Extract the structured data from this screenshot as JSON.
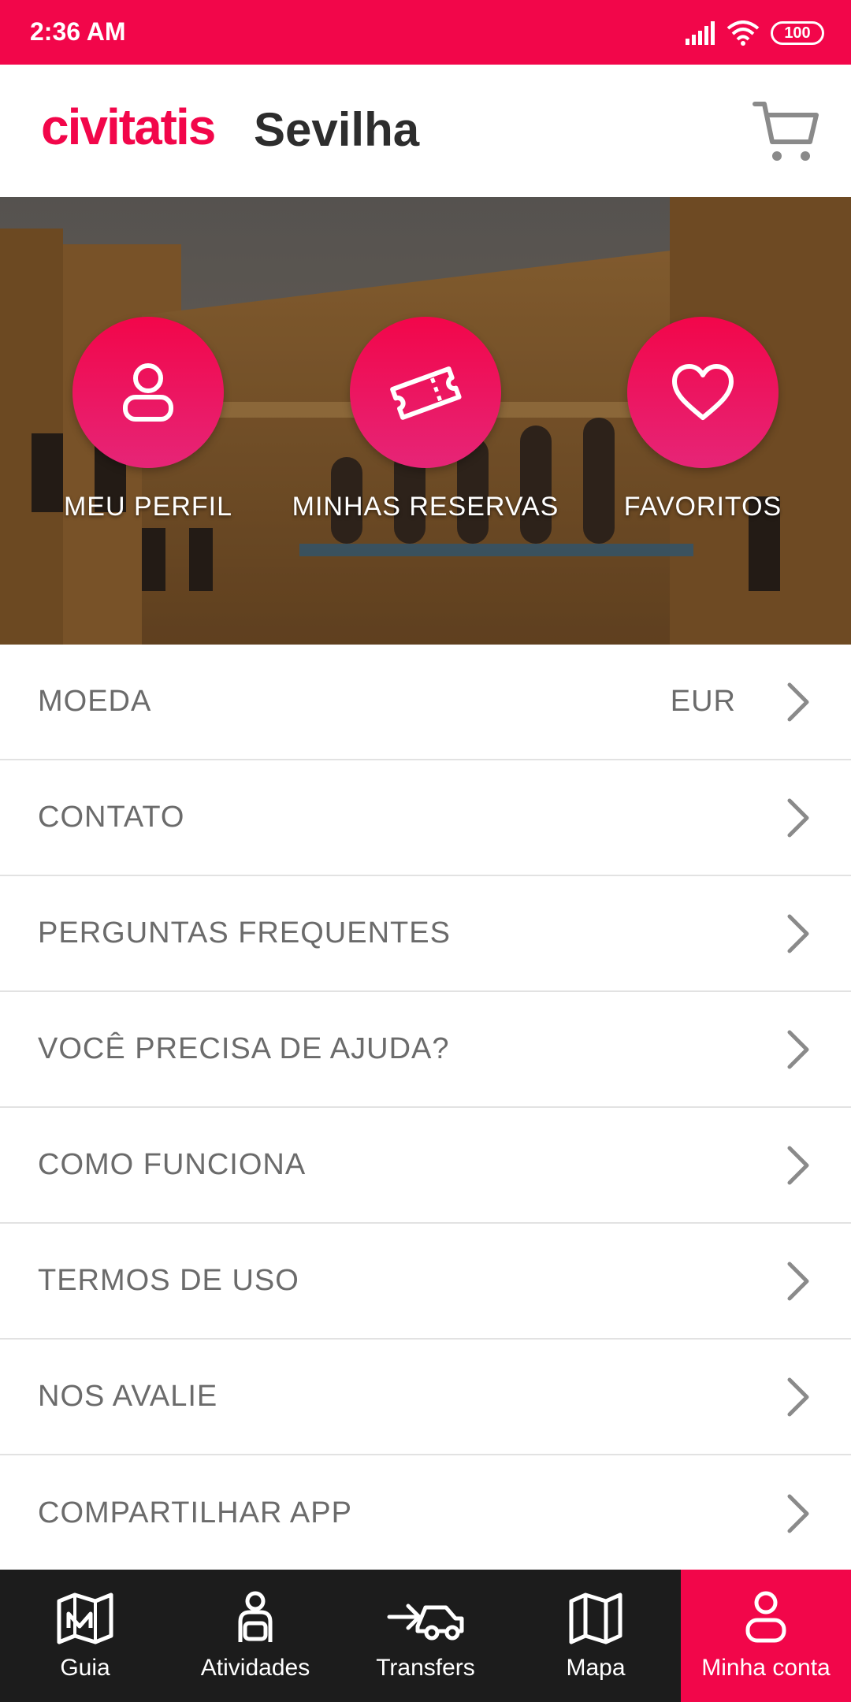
{
  "status_bar": {
    "time": "2:36 AM",
    "battery": "100"
  },
  "header": {
    "brand": "civitatis",
    "city": "Sevilha",
    "cart_icon": "cart-icon"
  },
  "hero": {
    "items": [
      {
        "label": "MEU PERFIL",
        "icon": "user-icon"
      },
      {
        "label": "MINHAS RESERVAS",
        "icon": "ticket-icon"
      },
      {
        "label": "FAVORITOS",
        "icon": "heart-icon"
      }
    ]
  },
  "menu": {
    "items": [
      {
        "label": "MOEDA",
        "value": "EUR"
      },
      {
        "label": "CONTATO"
      },
      {
        "label": "PERGUNTAS FREQUENTES"
      },
      {
        "label": "VOCÊ PRECISA DE AJUDA?"
      },
      {
        "label": "COMO FUNCIONA"
      },
      {
        "label": "TERMOS DE USO"
      },
      {
        "label": "NOS AVALIE"
      },
      {
        "label": "COMPARTILHAR APP"
      }
    ]
  },
  "bottom_nav": {
    "items": [
      {
        "label": "Guia",
        "icon": "map-pin-book-icon"
      },
      {
        "label": "Atividades",
        "icon": "traveler-icon"
      },
      {
        "label": "Transfers",
        "icon": "transfer-car-icon"
      },
      {
        "label": "Mapa",
        "icon": "map-icon"
      },
      {
        "label": "Minha conta",
        "icon": "user-icon",
        "active": true
      }
    ]
  },
  "colors": {
    "brand": "#f2064a",
    "nav_background": "#1c1c1c",
    "menu_text": "#6b6b6b"
  }
}
